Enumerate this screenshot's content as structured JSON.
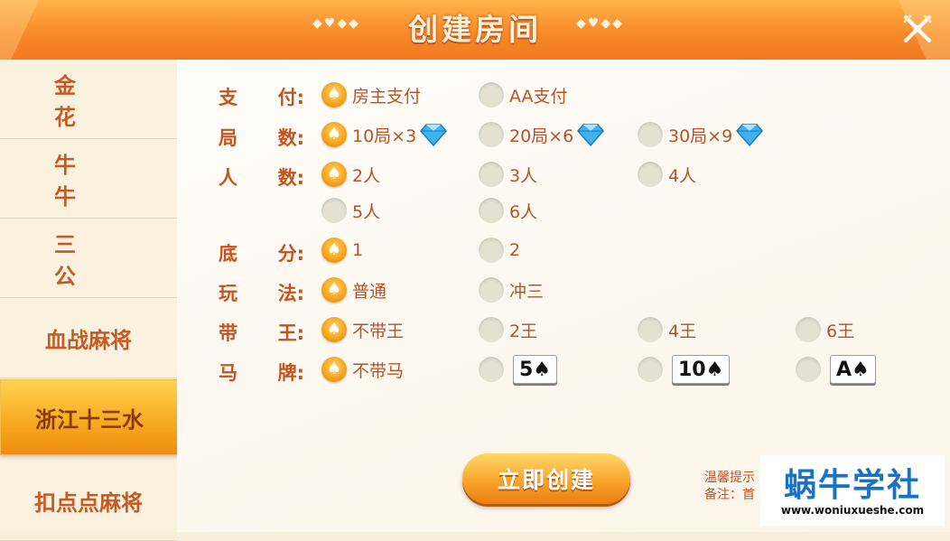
{
  "header": {
    "title": "创建房间",
    "deco_left": "◆♥◆◆",
    "deco_right": "◆♥◆◆",
    "close_icon": "close-x-icon"
  },
  "sidebar": {
    "items": [
      {
        "label": "金花",
        "wide": true
      },
      {
        "label": "牛牛",
        "wide": true
      },
      {
        "label": "三公",
        "wide": true
      },
      {
        "label": "血战麻将",
        "wide": false
      },
      {
        "label": "浙江十三水",
        "wide": false,
        "active": true
      },
      {
        "label": "扣点点麻将",
        "wide": false
      }
    ]
  },
  "rows": {
    "pay": {
      "label_a": "支",
      "label_b": "付:",
      "options": [
        "房主支付",
        "AA支付"
      ],
      "selected": 0
    },
    "rounds": {
      "label_a": "局",
      "label_b": "数:",
      "options": [
        "10局×3",
        "20局×6",
        "30局×9"
      ],
      "selected": 0,
      "icon": "diamond-icon"
    },
    "players": {
      "label_a": "人",
      "label_b": "数:",
      "options": [
        "2人",
        "3人",
        "4人",
        "5人",
        "6人"
      ],
      "selected": 0
    },
    "base": {
      "label_a": "底",
      "label_b": "分:",
      "options": [
        "1",
        "2"
      ],
      "selected": 0
    },
    "mode": {
      "label_a": "玩",
      "label_b": "法:",
      "options": [
        "普通",
        "冲三"
      ],
      "selected": 0
    },
    "jokers": {
      "label_a": "带",
      "label_b": "王:",
      "options": [
        "不带王",
        "2王",
        "4王",
        "6王"
      ],
      "selected": 0
    },
    "horse": {
      "label_a": "马",
      "label_b": "牌:",
      "options": [
        "不带马",
        "5♠",
        "10♠",
        "A♠"
      ],
      "selected": 0
    }
  },
  "create_button": "立即创建",
  "tips": {
    "line1": "温馨提示",
    "line2": "备注：首"
  },
  "watermark": {
    "name": "蜗牛学社",
    "url": "www.woniuxueshe.com"
  },
  "colors": {
    "accent": "#f7a821",
    "label": "#c4531e",
    "text": "#b4532b"
  }
}
